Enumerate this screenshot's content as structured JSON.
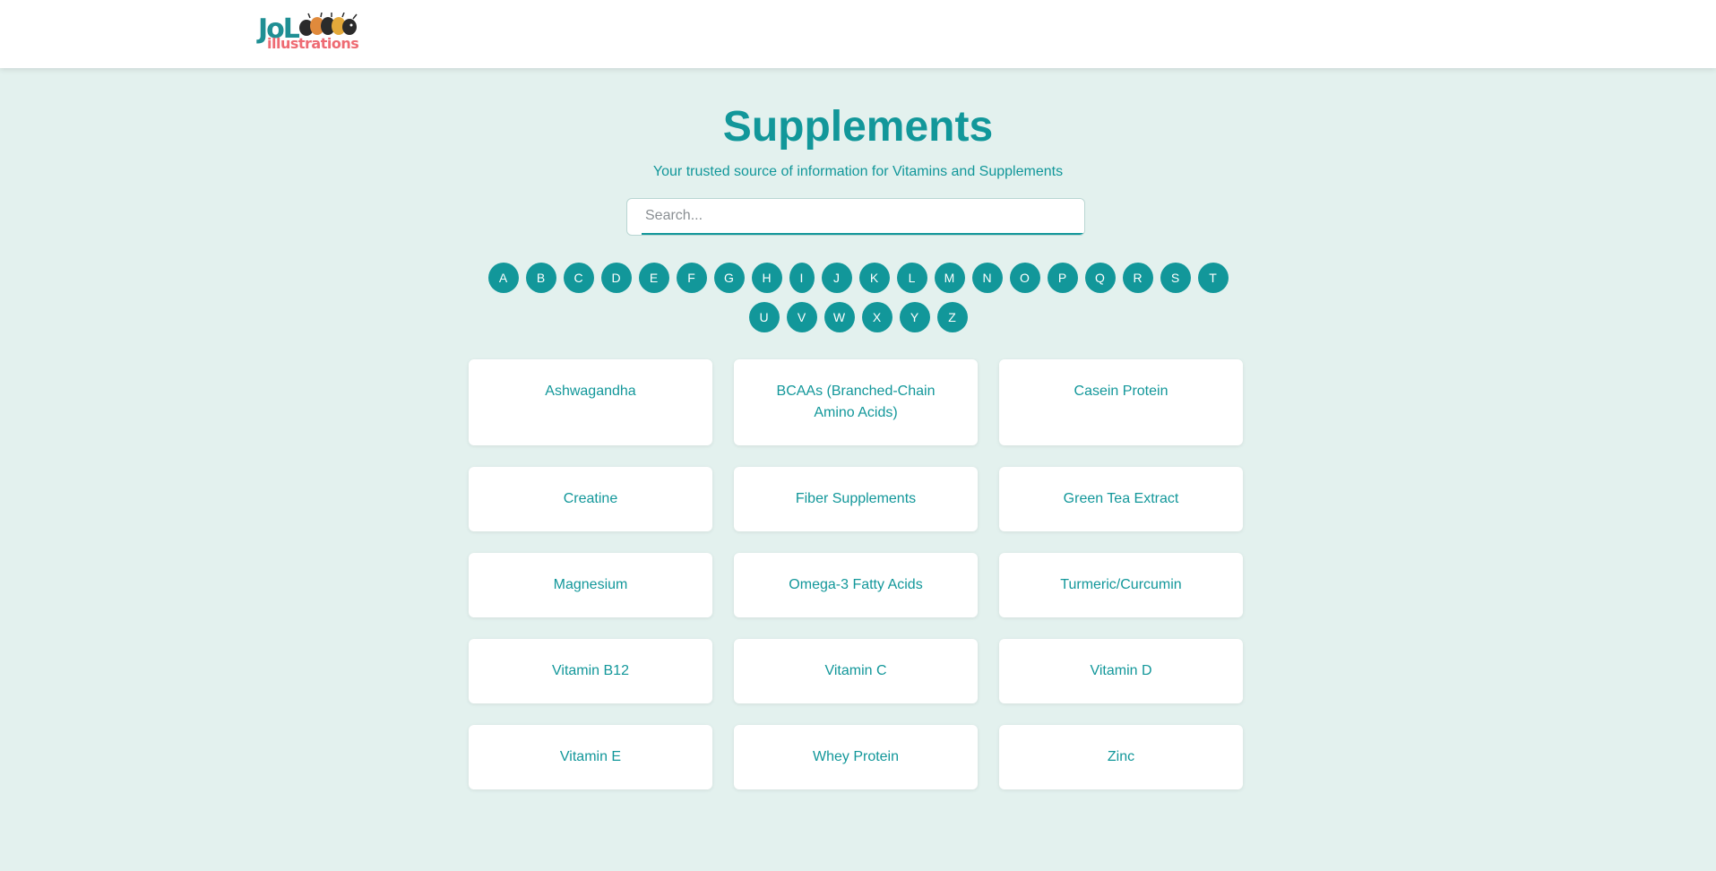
{
  "header": {
    "logo_main": "JoL",
    "logo_sub": "illustrations"
  },
  "hero": {
    "title": "Supplements",
    "subtitle": "Your trusted source of information for Vitamins and Supplements"
  },
  "search": {
    "placeholder": "Search...",
    "value": ""
  },
  "letters": [
    "A",
    "B",
    "C",
    "D",
    "E",
    "F",
    "G",
    "H",
    "I",
    "J",
    "K",
    "L",
    "M",
    "N",
    "O",
    "P",
    "Q",
    "R",
    "S",
    "T",
    "U",
    "V",
    "W",
    "X",
    "Y",
    "Z"
  ],
  "supplements": [
    "Ashwagandha",
    "BCAAs (Branched-Chain Amino Acids)",
    "Casein Protein",
    "Creatine",
    "Fiber Supplements",
    "Green Tea Extract",
    "Magnesium",
    "Omega-3 Fatty Acids",
    "Turmeric/Curcumin",
    "Vitamin B12",
    "Vitamin C",
    "Vitamin D",
    "Vitamin E",
    "Whey Protein",
    "Zinc"
  ],
  "colors": {
    "accent": "#12979a",
    "background": "#e3f1ee",
    "logo_teal": "#1f8f94",
    "logo_pink": "#ee6b73"
  }
}
